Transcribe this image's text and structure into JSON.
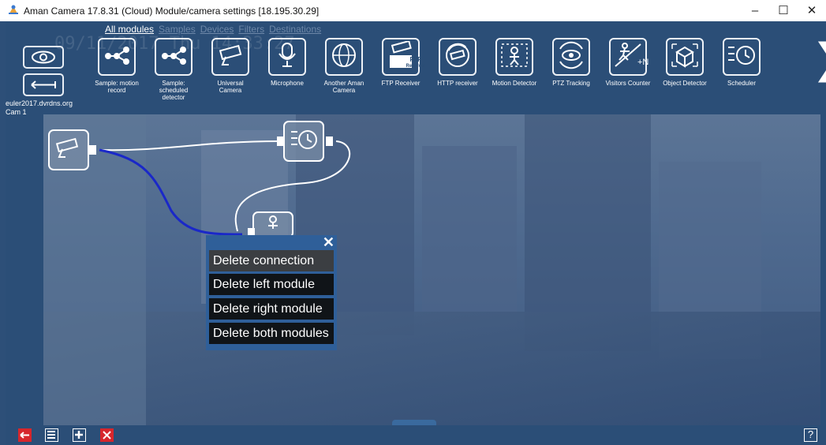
{
  "window": {
    "title": "Aman Camera 17.8.31 (Cloud) Module/camera settings [18.195.30.29]",
    "minimize": "–",
    "maximize": "☐",
    "close": "✕"
  },
  "tabs": [
    {
      "label": "All modules"
    },
    {
      "label": "Samples"
    },
    {
      "label": "Devices"
    },
    {
      "label": "Filters"
    },
    {
      "label": "Destinations"
    }
  ],
  "camera": {
    "host": "euler2017.dvrdns.org",
    "cam": "Cam  1",
    "timestamp": "09/11/2017 Thu 14:33:27"
  },
  "modules": [
    {
      "label": "Sample: motion record",
      "icon": "share-nodes-icon"
    },
    {
      "label": "Sample: scheduled detector",
      "icon": "share-nodes-icon"
    },
    {
      "label": "Universal Camera",
      "icon": "camera-icon"
    },
    {
      "label": "Microphone",
      "icon": "microphone-icon"
    },
    {
      "label": "Another Aman Camera",
      "icon": "globe-camera-icon"
    },
    {
      "label": "FTP Receiver",
      "icon": "ftp-camera-icon",
      "badge1": "FTP",
      "badge2": "Receiver"
    },
    {
      "label": "HTTP receiver",
      "icon": "http-camera-icon"
    },
    {
      "label": "Motion Detector",
      "icon": "motion-detector-icon"
    },
    {
      "label": "PTZ Tracking",
      "icon": "eye-rotate-icon"
    },
    {
      "label": "Visitors Counter",
      "icon": "visitors-counter-icon",
      "badge1": "+N"
    },
    {
      "label": "Object Detector",
      "icon": "box-icon"
    },
    {
      "label": "Scheduler",
      "icon": "schedule-clock-icon"
    }
  ],
  "context_menu": {
    "close": "✕",
    "items": [
      {
        "label": "Delete connection"
      },
      {
        "label": "Delete left module"
      },
      {
        "label": "Delete right module"
      },
      {
        "label": "Delete both modules"
      }
    ]
  },
  "bottom": {
    "help": "?"
  },
  "colors": {
    "background": "#2b4e77",
    "link_highlight": "#1a28c8",
    "menu_bg": "#101418",
    "bottom_red": "#d7262c"
  }
}
